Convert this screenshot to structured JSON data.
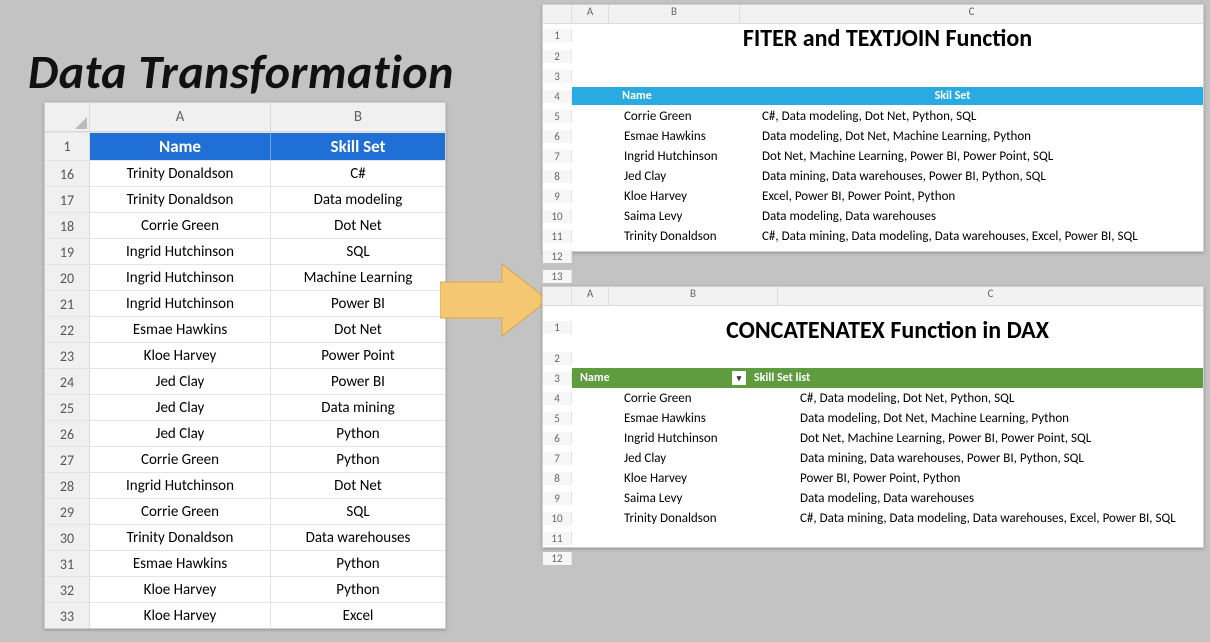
{
  "page_title": "Data Transformation",
  "left": {
    "col_letters": [
      "A",
      "B"
    ],
    "header_rownum": "1",
    "headers": {
      "name": "Name",
      "skill": "Skill Set"
    },
    "rows": [
      {
        "n": "16",
        "name": "Trinity Donaldson",
        "skill": "C#"
      },
      {
        "n": "17",
        "name": "Trinity Donaldson",
        "skill": "Data modeling"
      },
      {
        "n": "18",
        "name": "Corrie Green",
        "skill": "Dot Net"
      },
      {
        "n": "19",
        "name": "Ingrid Hutchinson",
        "skill": "SQL"
      },
      {
        "n": "20",
        "name": "Ingrid Hutchinson",
        "skill": "Machine Learning"
      },
      {
        "n": "21",
        "name": "Ingrid Hutchinson",
        "skill": "Power BI"
      },
      {
        "n": "22",
        "name": "Esmae Hawkins",
        "skill": "Dot Net"
      },
      {
        "n": "23",
        "name": "Kloe Harvey",
        "skill": "Power Point"
      },
      {
        "n": "24",
        "name": "Jed Clay",
        "skill": "Power BI"
      },
      {
        "n": "25",
        "name": "Jed Clay",
        "skill": "Data mining"
      },
      {
        "n": "26",
        "name": "Jed Clay",
        "skill": "Python"
      },
      {
        "n": "27",
        "name": "Corrie Green",
        "skill": "Python"
      },
      {
        "n": "28",
        "name": "Ingrid Hutchinson",
        "skill": "Dot Net"
      },
      {
        "n": "29",
        "name": "Corrie Green",
        "skill": "SQL"
      },
      {
        "n": "30",
        "name": "Trinity Donaldson",
        "skill": "Data warehouses"
      },
      {
        "n": "31",
        "name": "Esmae Hawkins",
        "skill": "Python"
      },
      {
        "n": "32",
        "name": "Kloe Harvey",
        "skill": "Python"
      },
      {
        "n": "33",
        "name": "Kloe Harvey",
        "skill": "Excel"
      }
    ]
  },
  "panel1": {
    "title": "FITER and TEXTJOIN Function",
    "col_letters": [
      "A",
      "B",
      "C"
    ],
    "headers": {
      "name": "Name",
      "skill": "Skil Set"
    },
    "row_numbers": [
      "1",
      "2",
      "3",
      "4",
      "5",
      "6",
      "7",
      "8",
      "9",
      "10",
      "11",
      "12",
      "13"
    ],
    "rows": [
      {
        "name": "Corrie Green",
        "skill": "C#, Data modeling, Dot Net, Python, SQL"
      },
      {
        "name": "Esmae Hawkins",
        "skill": "Data modeling, Dot Net, Machine Learning, Python"
      },
      {
        "name": "Ingrid Hutchinson",
        "skill": "Dot Net, Machine Learning, Power BI, Power Point, SQL"
      },
      {
        "name": "Jed Clay",
        "skill": "Data mining, Data warehouses, Power BI, Python, SQL"
      },
      {
        "name": "Kloe Harvey",
        "skill": "Excel, Power BI, Power Point, Python"
      },
      {
        "name": "Saima Levy",
        "skill": "Data modeling, Data warehouses"
      },
      {
        "name": "Trinity Donaldson",
        "skill": "C#, Data mining, Data modeling, Data warehouses, Excel, Power BI, SQL"
      }
    ]
  },
  "panel2": {
    "title": "CONCATENATEX Function in DAX",
    "col_letters": [
      "A",
      "B",
      "C"
    ],
    "headers": {
      "name": "Name",
      "skill": "Skill Set list"
    },
    "row_numbers": [
      "1",
      "2",
      "3",
      "4",
      "5",
      "6",
      "7",
      "8",
      "9",
      "10",
      "11",
      "12"
    ],
    "rows": [
      {
        "name": "Corrie Green",
        "skill": "C#, Data modeling, Dot Net, Python, SQL"
      },
      {
        "name": "Esmae Hawkins",
        "skill": "Data modeling, Dot Net, Machine Learning, Python"
      },
      {
        "name": "Ingrid Hutchinson",
        "skill": "Dot Net, Machine Learning, Power BI, Power Point, SQL"
      },
      {
        "name": "Jed Clay",
        "skill": "Data mining, Data warehouses, Power BI, Python, SQL"
      },
      {
        "name": "Kloe Harvey",
        "skill": "Power BI, Power Point, Python"
      },
      {
        "name": "Saima Levy",
        "skill": "Data modeling, Data warehouses"
      },
      {
        "name": "Trinity Donaldson",
        "skill": "C#, Data mining, Data modeling, Data warehouses, Excel, Power BI, SQL"
      }
    ]
  }
}
